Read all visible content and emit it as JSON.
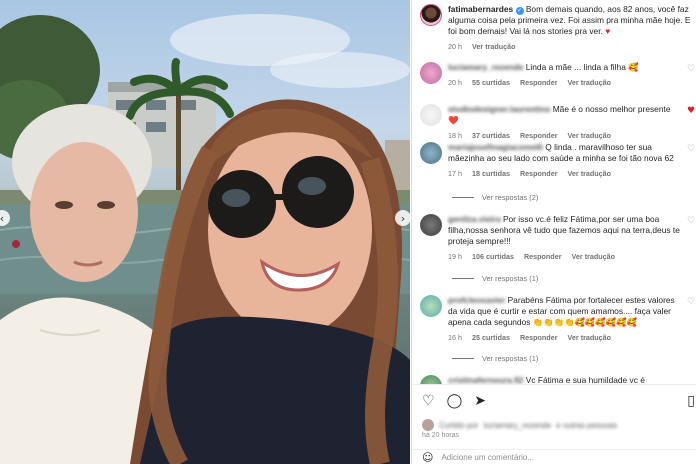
{
  "post": {
    "photo_alt": "Selfie of two women in front of a waterfront with palm trees and a building",
    "nav_prev_icon": "chevron-left-icon",
    "nav_next_icon": "chevron-right-icon"
  },
  "caption": {
    "username": "fatimabernardes",
    "verified_icon": "verified-badge-icon",
    "text": "Bom demais quando, aos 82 anos, você faz alguma coisa pela primeira vez. Foi assim pra minha mãe hoje. E foi bom demais! Vai lá nos stories pra ver.",
    "time": "20 h",
    "translate": "Ver tradução"
  },
  "comments": [
    {
      "username": "luciamary_rezende",
      "text": "Linda a mãe ... linda a filha 🥰",
      "time": "20 h",
      "likes": "55 curtidas",
      "reply": "Responder",
      "translate": "Ver tradução",
      "heart": "outline",
      "replies": ""
    },
    {
      "username": "studiodesigner.laurentino",
      "text": "Mãe é o nosso melhor presente ❤️",
      "time": "18 h",
      "likes": "37 curtidas",
      "reply": "Responder",
      "translate": "Ver tradução",
      "heart": "red",
      "replies": ""
    },
    {
      "username": "mariajosefinagiacomelli",
      "text": "Q linda . maravilhoso ter sua mãezinha ao seu lado com saúde a minha se foi tão nova 62",
      "time": "17 h",
      "likes": "18 curtidas",
      "reply": "Responder",
      "translate": "Ver tradução",
      "heart": "outline",
      "replies": "Ver respostas (2)"
    },
    {
      "username": "genilza.vieira",
      "text": "Por isso vc.é feliz Fátima,por ser uma boa filha,nossa senhora vê tudo que fazemos aqui na terra,deus te proteja sempre!!!",
      "time": "19 h",
      "likes": "106 curtidas",
      "reply": "Responder",
      "translate": "Ver tradução",
      "heart": "outline",
      "replies": "Ver respostas (1)"
    },
    {
      "username": "profcleoxavier",
      "text": "Parabéns Fátima por fortalecer estes valores da vida que é curtir e estar com quem amamos.... faça valer apena cada segundos 👏👏👏👏🥰🥰🥰🥰🥰🥰",
      "time": "16 h",
      "likes": "25 curtidas",
      "reply": "Responder",
      "translate": "Ver tradução",
      "heart": "outline",
      "replies": "Ver respostas (1)"
    },
    {
      "username": "cristinafernoura.92",
      "text": "Vc Fátima e sua humildade vc é",
      "time": "",
      "likes": "",
      "reply": "",
      "translate": "",
      "heart": "outline",
      "replies": ""
    }
  ],
  "actions": {
    "like_icon": "heart-outline-icon",
    "comment_icon": "comment-bubble-icon",
    "share_icon": "paper-plane-icon",
    "save_icon": "bookmark-icon",
    "liked_by_prefix": "Curtido por",
    "liked_by_user": "luciamary_rezende",
    "liked_by_suffix": "e outras pessoas",
    "time_ago": "há 20 horas",
    "emoji_icon": "smiley-face-icon",
    "add_comment_placeholder": "Adicione um comentário..."
  },
  "colors": {
    "verified": "#3897f0",
    "heart_red": "#d8232a",
    "secondary_text": "#737373",
    "avatar_ring": "#d94d8a"
  }
}
